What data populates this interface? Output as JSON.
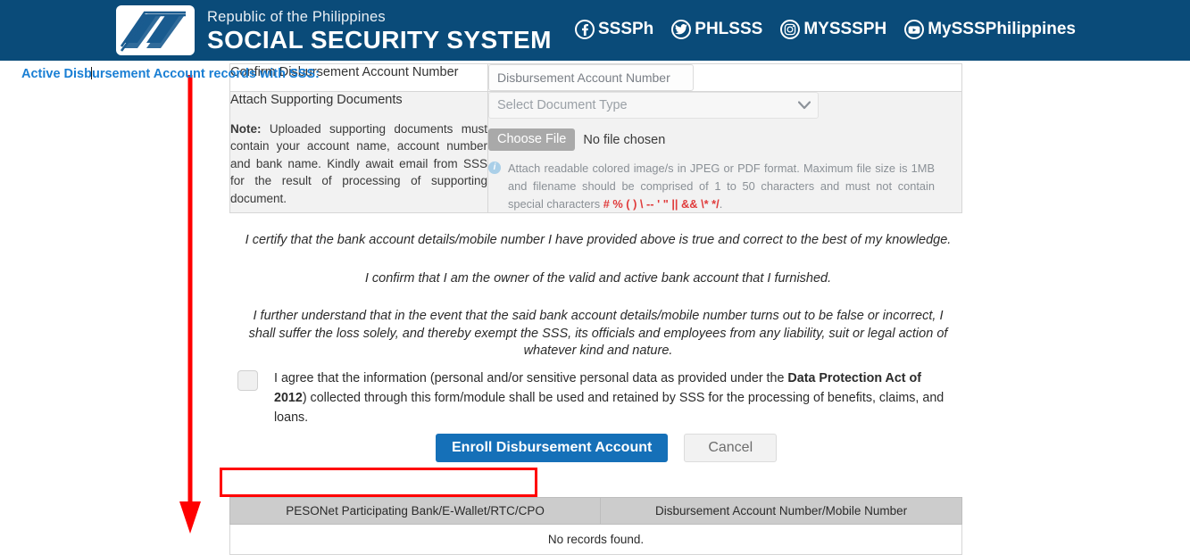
{
  "header": {
    "logo_alt": "sss-logo",
    "line1": "Republic of the Philippines",
    "line2": "SOCIAL SECURITY SYSTEM",
    "socials": [
      {
        "icon": "facebook-icon",
        "label": "SSSPh"
      },
      {
        "icon": "twitter-icon",
        "label": "PHLSSS"
      },
      {
        "icon": "instagram-icon",
        "label": "MYSSSPH"
      },
      {
        "icon": "youtube-icon",
        "label": "MySSSPhilippines"
      }
    ]
  },
  "form": {
    "confirm_label": "Confirm Disbursement Account Number",
    "confirm_placeholder": "Disbursement Account Number",
    "confirm_value": "",
    "attach_label": "Attach Supporting Documents",
    "attach_note_prefix": "Note:",
    "attach_note": " Uploaded supporting documents must contain your account name, account number and bank name. Kindly await email from SSS for the result of processing of supporting document.",
    "doc_type_selected": "Select Document Type",
    "choose_file_label": "Choose File",
    "no_file_label": "No file chosen",
    "info_icon": "info-icon",
    "info_text": "Attach readable colored image/s in JPEG or PDF format. Maximum file size is 1MB and filename should be comprised of 1 to 50 characters and must not contain special characters ",
    "info_specials": "# % ( ) \\ -- ' \" || && \\* */",
    "info_period": "."
  },
  "certifications": [
    "I certify that the bank account details/mobile number I have provided above is true and correct to the best of my knowledge.",
    "I confirm that I am the owner of the valid and active bank account that I furnished.",
    "I further understand that in the event that the said bank account details/mobile number turns out to be false or incorrect, I shall suffer the loss solely, and thereby exempt the SSS, its officials and employees from any liability, suit or legal action of whatever kind and nature."
  ],
  "agreement": {
    "checked": false,
    "part1": "I agree that the information (personal and/or sensitive personal data as provided under the ",
    "bold": "Data Protection Act of 2012",
    "part2": ") collected through this form/module shall be used and retained by SSS for the processing of benefits, claims, and loans."
  },
  "buttons": {
    "enroll": "Enroll Disbursement Account",
    "cancel": "Cancel"
  },
  "records": {
    "title_before_caret": "Active Disb",
    "title_after_caret": "ursement Account records with SSS:",
    "columns": [
      "PESONet Participating Bank/E-Wallet/RTC/CPO",
      "Disbursement Account Number/Mobile Number"
    ],
    "empty_message": "No records found.",
    "rows": []
  },
  "annotations": {
    "arrow_color": "#ff0000",
    "highlight_color": "#ff0000"
  },
  "colors": {
    "header_blue": "#0a4b79",
    "primary_button": "#1570b8",
    "link_blue": "#1a7fd4",
    "special_chars_red": "#e03b3b"
  }
}
